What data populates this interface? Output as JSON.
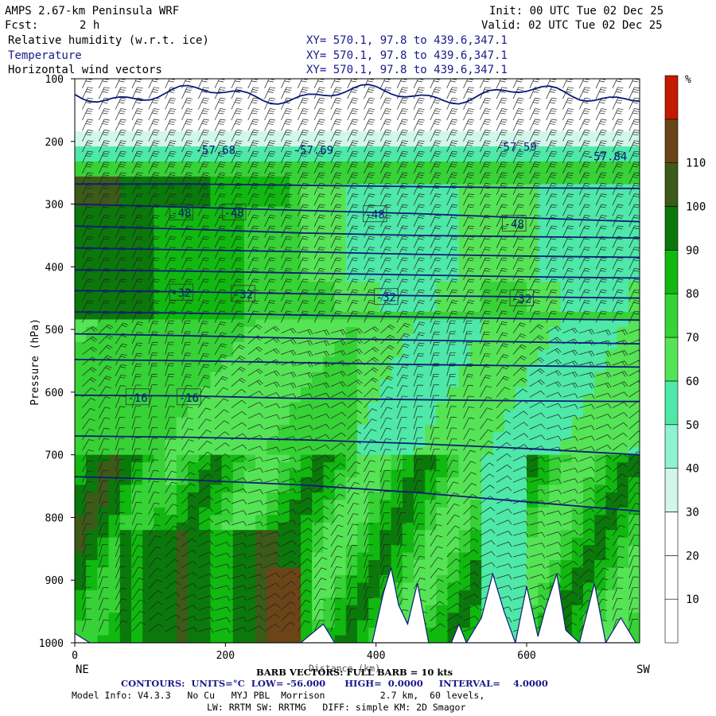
{
  "header": {
    "title": "AMPS 2.67-km Peninsula WRF",
    "init": "Init: 00 UTC Tue 02 Dec 25",
    "fcst_label": "Fcst:",
    "fcst_value": "2 h",
    "valid": "Valid: 02 UTC Tue 02 Dec 25",
    "fields": [
      {
        "label": "Relative humidity (w.r.t. ice)",
        "xy": "XY= 570.1, 97.8 to 439.6,347.1"
      },
      {
        "label": "Temperature",
        "xy": "XY= 570.1, 97.8 to 439.6,347.1"
      },
      {
        "label": "Horizontal wind vectors",
        "xy": "XY= 570.1, 97.8 to 439.6,347.1"
      }
    ]
  },
  "colors": {
    "temp_contour": "#0d1a7a",
    "barb": "#222222",
    "terrain": "#ffffff"
  },
  "chart_data": {
    "type": "heatmap",
    "title": "Relative humidity (w.r.t. ice) cross-section",
    "xlabel": "Distance (km)",
    "ylabel": "Pressure (hPa)",
    "xlim": [
      0,
      750
    ],
    "ylim": [
      1000,
      100
    ],
    "x_ticks": [
      0,
      200,
      400,
      600
    ],
    "y_ticks": [
      100,
      200,
      300,
      400,
      500,
      600,
      700,
      800,
      900,
      1000
    ],
    "x_endpoint_labels": {
      "left": "NE",
      "right": "SW"
    },
    "colorbar": {
      "unit": "%",
      "ticks": [
        10,
        20,
        30,
        40,
        50,
        60,
        70,
        80,
        90,
        100,
        110
      ],
      "bins": [
        {
          "from": 0,
          "to": 10,
          "color": "#ffffff"
        },
        {
          "from": 10,
          "to": 20,
          "color": "#ffffff"
        },
        {
          "from": 20,
          "to": 30,
          "color": "#ffffff"
        },
        {
          "from": 30,
          "to": 40,
          "color": "#d2f7ea"
        },
        {
          "from": 40,
          "to": 50,
          "color": "#8ff2d2"
        },
        {
          "from": 50,
          "to": 60,
          "color": "#4ee8a8"
        },
        {
          "from": 60,
          "to": 70,
          "color": "#55e455"
        },
        {
          "from": 70,
          "to": 80,
          "color": "#36d236"
        },
        {
          "from": 80,
          "to": 90,
          "color": "#10b810"
        },
        {
          "from": 90,
          "to": 100,
          "color": "#0b780b"
        },
        {
          "from": 100,
          "to": 110,
          "color": "#3c5a18"
        },
        {
          "from": 110,
          "to": 120,
          "color": "#6b4418"
        },
        {
          "from": 120,
          "to": 130,
          "color": "#c41a00"
        }
      ]
    },
    "temperature_labels": [
      {
        "text": "-57.68",
        "x": 160,
        "p": 215
      },
      {
        "text": "-57.69",
        "x": 290,
        "p": 215
      },
      {
        "text": "-57.59",
        "x": 560,
        "p": 210
      },
      {
        "text": "-57.84",
        "x": 680,
        "p": 225
      },
      {
        "text": "-48",
        "x": 128,
        "p": 315
      },
      {
        "text": "-48",
        "x": 198,
        "p": 315
      },
      {
        "text": "-48",
        "x": 385,
        "p": 318
      },
      {
        "text": "-48",
        "x": 570,
        "p": 333
      },
      {
        "text": "-32",
        "x": 128,
        "p": 443
      },
      {
        "text": "-32",
        "x": 210,
        "p": 445
      },
      {
        "text": "-32",
        "x": 400,
        "p": 450
      },
      {
        "text": "-32",
        "x": 580,
        "p": 452
      },
      {
        "text": "-16",
        "x": 70,
        "p": 610
      },
      {
        "text": "-16",
        "x": 138,
        "p": 610
      }
    ],
    "temperature_isotherms": [
      {
        "T": -52,
        "p": [
          268,
          268,
          270,
          272,
          274,
          275
        ]
      },
      {
        "T": -48,
        "p": [
          300,
          305,
          310,
          315,
          322,
          328
        ]
      },
      {
        "T": -44,
        "p": [
          335,
          340,
          346,
          350,
          352,
          354
        ]
      },
      {
        "T": -40,
        "p": [
          370,
          373,
          376,
          380,
          383,
          385
        ]
      },
      {
        "T": -36,
        "p": [
          405,
          407,
          410,
          413,
          416,
          418
        ]
      },
      {
        "T": -32,
        "p": [
          438,
          440,
          443,
          446,
          448,
          450
        ]
      },
      {
        "T": -28,
        "p": [
          472,
          474,
          477,
          480,
          483,
          485
        ]
      },
      {
        "T": -24,
        "p": [
          507,
          510,
          514,
          517,
          520,
          523
        ]
      },
      {
        "T": -20,
        "p": [
          548,
          550,
          553,
          556,
          558,
          560
        ]
      },
      {
        "T": -16,
        "p": [
          605,
          606,
          610,
          612,
          614,
          615
        ]
      },
      {
        "T": -12,
        "p": [
          670,
          672,
          676,
          682,
          690,
          700
        ]
      },
      {
        "T": -8,
        "p": [
          735,
          740,
          748,
          760,
          775,
          790
        ]
      }
    ],
    "terrain_profile": [
      {
        "x": 0,
        "p": 985
      },
      {
        "x": 20,
        "p": 1000
      },
      {
        "x": 40,
        "p": 1000
      },
      {
        "x": 300,
        "p": 1000
      },
      {
        "x": 330,
        "p": 970
      },
      {
        "x": 345,
        "p": 1000
      },
      {
        "x": 395,
        "p": 1000
      },
      {
        "x": 410,
        "p": 920
      },
      {
        "x": 420,
        "p": 880
      },
      {
        "x": 430,
        "p": 940
      },
      {
        "x": 442,
        "p": 970
      },
      {
        "x": 455,
        "p": 905
      },
      {
        "x": 470,
        "p": 1000
      },
      {
        "x": 500,
        "p": 1000
      },
      {
        "x": 510,
        "p": 970
      },
      {
        "x": 520,
        "p": 1000
      },
      {
        "x": 540,
        "p": 960
      },
      {
        "x": 555,
        "p": 890
      },
      {
        "x": 570,
        "p": 950
      },
      {
        "x": 585,
        "p": 1000
      },
      {
        "x": 600,
        "p": 910
      },
      {
        "x": 615,
        "p": 990
      },
      {
        "x": 625,
        "p": 945
      },
      {
        "x": 640,
        "p": 890
      },
      {
        "x": 652,
        "p": 980
      },
      {
        "x": 670,
        "p": 1000
      },
      {
        "x": 690,
        "p": 905
      },
      {
        "x": 705,
        "p": 1000
      },
      {
        "x": 725,
        "p": 960
      },
      {
        "x": 745,
        "p": 1000
      },
      {
        "x": 750,
        "p": 1000
      }
    ]
  },
  "footer": {
    "barb_vectors": "BARB VECTORS: FULL BARB = 10 kts",
    "xlabel_overlap": "Distance (km)",
    "contours": "CONTOURS:  UNITS=°C  LOW= -56.000      HIGH=  0.0000     INTERVAL=    4.0000",
    "model_info_1": "Model Info: V4.3.3   No Cu   MYJ PBL  Morrison          2.7 km,  60 levels,",
    "model_info_2": "LW: RRTM SW: RRTMG   DIFF: simple KM: 2D Smagor"
  }
}
